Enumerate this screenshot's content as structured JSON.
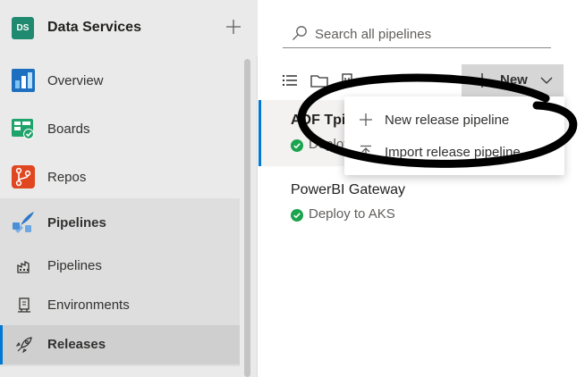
{
  "project": {
    "initials": "DS",
    "name": "Data Services",
    "avatar_color": "#1f8a70"
  },
  "sidebar": {
    "items": [
      {
        "label": "Overview",
        "icon": "overview-icon"
      },
      {
        "label": "Boards",
        "icon": "boards-icon"
      },
      {
        "label": "Repos",
        "icon": "repos-icon"
      }
    ],
    "pipelines_group": {
      "label": "Pipelines",
      "icon": "pipelines-icon",
      "children": [
        {
          "label": "Pipelines",
          "icon": "pipelines-sub-icon"
        },
        {
          "label": "Environments",
          "icon": "environments-icon"
        },
        {
          "label": "Releases",
          "icon": "releases-icon",
          "active": true
        }
      ]
    }
  },
  "search": {
    "placeholder": "Search all pipelines"
  },
  "toolbar": {
    "new_label": "New"
  },
  "pipelines": [
    {
      "name": "ADF Tpipeline",
      "status": "Deploy to AKS",
      "status_color": "#107c10"
    },
    {
      "name": "PowerBI Gateway",
      "status": "Deploy to AKS",
      "status_color": "#107c10"
    }
  ],
  "new_menu": {
    "items": [
      {
        "label": "New release pipeline",
        "icon": "plus-icon"
      },
      {
        "label": "Import release pipeline",
        "icon": "import-icon"
      }
    ]
  },
  "colors": {
    "accent": "#0078d4",
    "success": "#107c10"
  }
}
